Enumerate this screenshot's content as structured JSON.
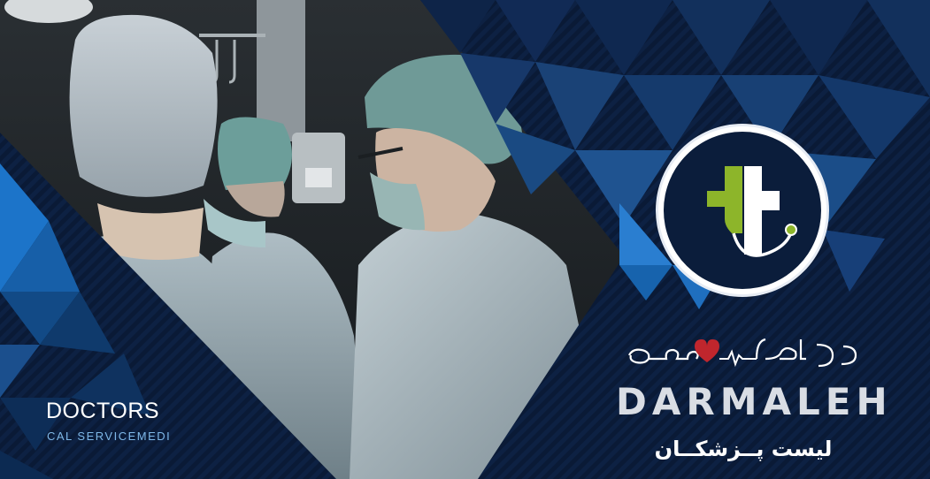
{
  "left_panel": {
    "title": "DOCTORS",
    "subtitle": "CAL SERVICEMEDI"
  },
  "brand": {
    "script_text": "درملــــه",
    "name": "DARMALEH",
    "tagline": "لیست پــزشکــان"
  },
  "colors": {
    "navy": "#0b1a33",
    "accent_blue": "#1e7fd6",
    "logo_green": "#8db52a",
    "heart_red": "#c0262d"
  },
  "icons": [
    "medical-cross-logo-icon",
    "heart-icon",
    "heartbeat-line-icon",
    "stethoscope-icon"
  ]
}
